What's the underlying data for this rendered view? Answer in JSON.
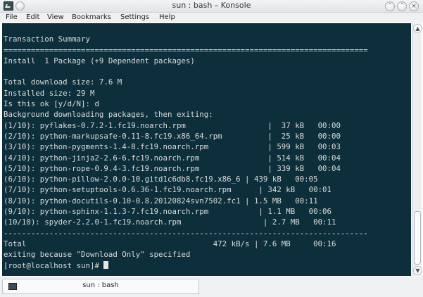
{
  "window": {
    "title": "sun : bash – Konsole",
    "buttons": {
      "minimize": "˅",
      "maximize": "˄",
      "close": "×"
    }
  },
  "menu": {
    "items": [
      "File",
      "Edit",
      "View",
      "Bookmarks",
      "Settings",
      "Help"
    ]
  },
  "terminal": {
    "background": "#0d2f3b",
    "foreground": "#d9dcdc",
    "lines": [
      "",
      "Transaction Summary",
      "================================================================================",
      "Install  1 Package (+9 Dependent packages)",
      "",
      "Total download size: 7.6 M",
      "Installed size: 29 M",
      "Is this ok [y/d/N]: d",
      "Background downloading packages, then exiting:",
      "(1/10): pyflakes-0.7.2-1.fc19.noarch.rpm                  |  37 kB   00:00",
      "(2/10): python-markupsafe-0.11-8.fc19.x86_64.rpm          |  25 kB   00:00",
      "(3/10): python-pygments-1.4-8.fc19.noarch.rpm             | 599 kB   00:03",
      "(4/10): python-jinja2-2.6-6.fc19.noarch.rpm               | 514 kB   00:04",
      "(5/10): python-rope-0.9.4-3.fc19.noarch.rpm               | 339 kB   00:04",
      "(6/10): python-pillow-2.0.0-10.gitd1c6db8.fc19.x86_6 | 439 kB   00:05",
      "(7/10): python-setuptools-0.6.36-1.fc19.noarch.rpm      | 342 kB   00:01",
      "(8/10): python-docutils-0.10-0.8.20120824svn7502.fc1 | 1.5 MB   00:11",
      "(9/10): python-sphinx-1.1.3-7.fc19.noarch.rpm           | 1.1 MB   00:06",
      "(10/10): spyder-2.2.0-1.fc19.noarch.rpm                  | 2.7 MB   00:11",
      "--------------------------------------------------------------------------------",
      "Total                                         472 kB/s | 7.6 MB     00:16",
      "exiting because \"Download Only\" specified"
    ],
    "prompt": "[root@localhost sun]# "
  },
  "tab": {
    "label": "sun : bash"
  }
}
